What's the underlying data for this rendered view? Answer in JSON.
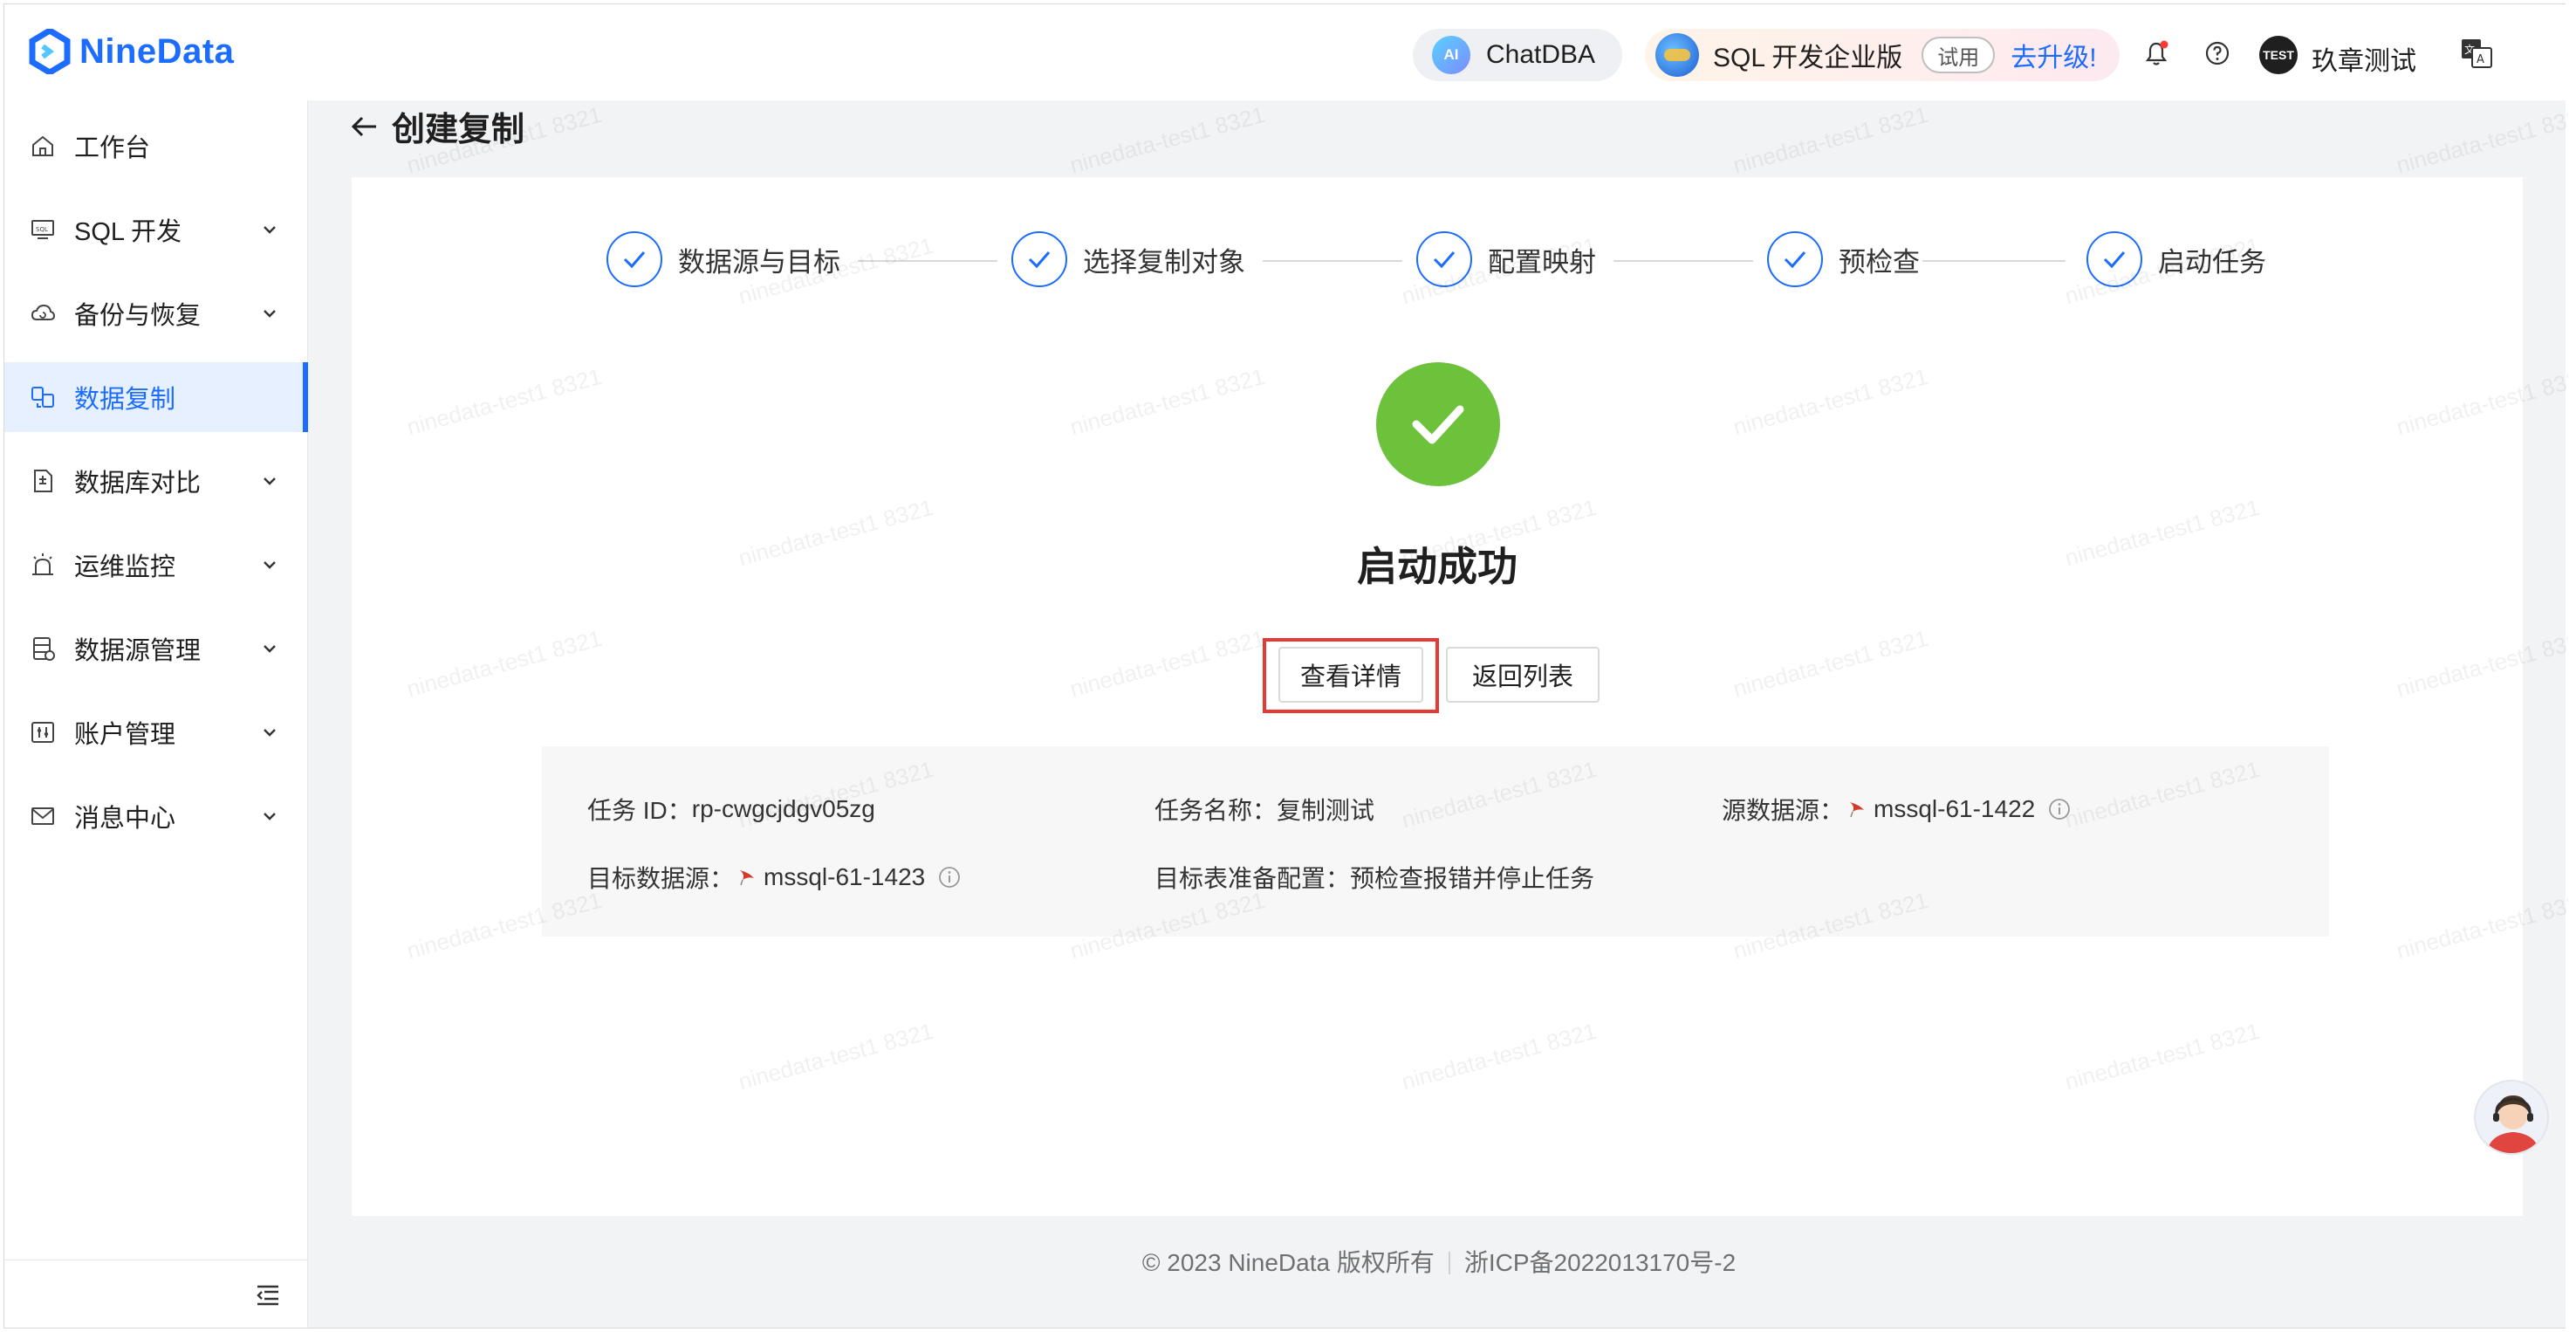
{
  "header": {
    "brand": "NineData",
    "chatdba_label": "ChatDBA",
    "ai_badge": "AI",
    "sql_edition_label": "SQL 开发企业版",
    "trial_badge": "试用",
    "upgrade_link": "去升级!",
    "user_avatar_text": "TEST",
    "user_name": "玖章测试"
  },
  "sidebar": {
    "items": [
      {
        "label": "工作台",
        "icon": "home-icon",
        "expandable": false
      },
      {
        "label": "SQL 开发",
        "icon": "sql-monitor-icon",
        "expandable": true
      },
      {
        "label": "备份与恢复",
        "icon": "cloud-backup-icon",
        "expandable": true
      },
      {
        "label": "数据复制",
        "icon": "replication-icon",
        "expandable": false,
        "active": true
      },
      {
        "label": "数据库对比",
        "icon": "compare-doc-icon",
        "expandable": true
      },
      {
        "label": "运维监控",
        "icon": "alarm-icon",
        "expandable": true
      },
      {
        "label": "数据源管理",
        "icon": "datasource-icon",
        "expandable": true
      },
      {
        "label": "账户管理",
        "icon": "account-icon",
        "expandable": true
      },
      {
        "label": "消息中心",
        "icon": "mail-icon",
        "expandable": true
      }
    ]
  },
  "page": {
    "title": "创建复制"
  },
  "steps": [
    {
      "label": "数据源与目标",
      "status": "done"
    },
    {
      "label": "选择复制对象",
      "status": "done"
    },
    {
      "label": "配置映射",
      "status": "done"
    },
    {
      "label": "预检查",
      "status": "done"
    },
    {
      "label": "启动任务",
      "status": "done"
    }
  ],
  "result": {
    "title": "启动成功",
    "view_details_button": "查看详情",
    "back_to_list_button": "返回列表"
  },
  "task_info": {
    "task_id_label": "任务 ID：",
    "task_id": "rp-cwgcjdgv05zg",
    "task_name_label": "任务名称：",
    "task_name": "复制测试",
    "source_label": "源数据源：",
    "source": "mssql-61-1422",
    "target_label": "目标数据源：",
    "target": "mssql-61-1423",
    "target_prep_label": "目标表准备配置：",
    "target_prep": "预检查报错并停止任务"
  },
  "watermark": "ninedata-test1 8321",
  "footer": {
    "copyright": "© 2023 NineData 版权所有",
    "icp": "浙ICP备2022013170号-2"
  },
  "colors": {
    "primary": "#1c6cff",
    "success": "#6cc23a",
    "highlight": "#e53935"
  }
}
